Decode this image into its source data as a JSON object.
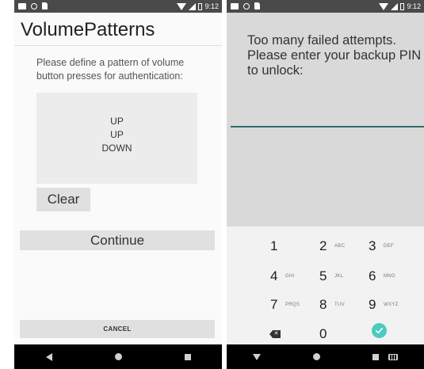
{
  "status_bar": {
    "time": "9:12"
  },
  "left_screen": {
    "app_title": "VolumePatterns",
    "instructions": "Please define a pattern of volume button presses for authentication:",
    "pattern": [
      "UP",
      "UP",
      "DOWN"
    ],
    "clear_label": "Clear",
    "continue_label": "Continue",
    "cancel_label": "CANCEL"
  },
  "right_screen": {
    "message": "Too many failed attempts. Please enter your backup PIN to unlock:",
    "keypad": [
      {
        "digit": "1",
        "letters": ""
      },
      {
        "digit": "2",
        "letters": "ABC"
      },
      {
        "digit": "3",
        "letters": "DEF"
      },
      {
        "digit": "4",
        "letters": "GHI"
      },
      {
        "digit": "5",
        "letters": "JKL"
      },
      {
        "digit": "6",
        "letters": "MNO"
      },
      {
        "digit": "7",
        "letters": "PRQS"
      },
      {
        "digit": "8",
        "letters": "TUV"
      },
      {
        "digit": "9",
        "letters": "WXYZ"
      },
      {
        "digit": "0",
        "letters": ""
      }
    ],
    "backspace_icon": "backspace-icon",
    "ok_icon": "checkmark-circle-icon"
  },
  "colors": {
    "accent": "#4ccbc0",
    "pin_underline": "#2e6b6b",
    "status_bar": "#4a4a4a",
    "nav_bar": "#000000"
  }
}
